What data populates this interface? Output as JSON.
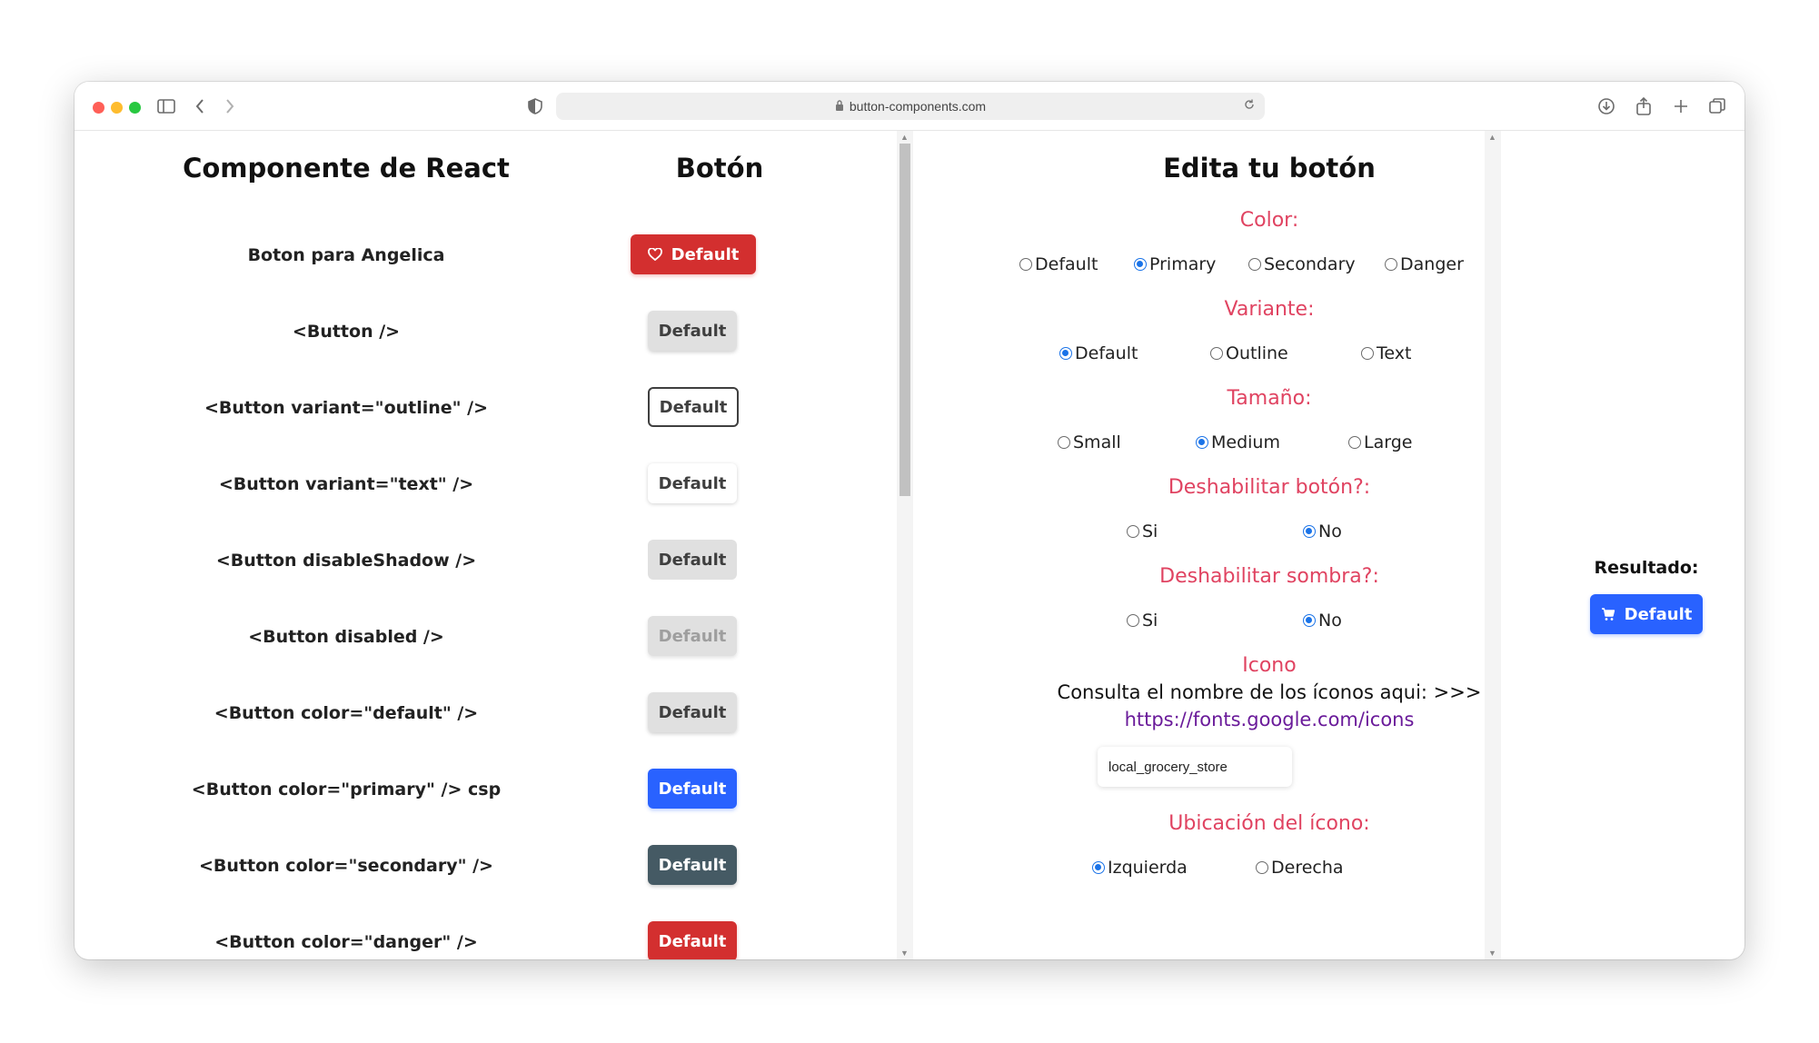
{
  "browser": {
    "url": "button-components.com"
  },
  "left": {
    "heading_component": "Componente de React",
    "heading_button": "Botón",
    "rows": [
      {
        "label": "Boton para Angelica",
        "button": "Default"
      },
      {
        "label": "<Button />",
        "button": "Default"
      },
      {
        "label": "<Button variant=\"outline\" />",
        "button": "Default"
      },
      {
        "label": "<Button variant=\"text\" />",
        "button": "Default"
      },
      {
        "label": "<Button disableShadow />",
        "button": "Default"
      },
      {
        "label": "<Button disabled />",
        "button": "Default"
      },
      {
        "label": "<Button color=\"default\" />",
        "button": "Default"
      },
      {
        "label": "<Button color=\"primary\" /> csp",
        "button": "Default"
      },
      {
        "label": "<Button color=\"secondary\" />",
        "button": "Default"
      },
      {
        "label": "<Button color=\"danger\" />",
        "button": "Default"
      }
    ]
  },
  "editor": {
    "heading": "Edita tu botón",
    "color": {
      "title": "Color:",
      "options": [
        "Default",
        "Primary",
        "Secondary",
        "Danger"
      ],
      "selected": "Primary"
    },
    "variant": {
      "title": "Variante:",
      "options": [
        "Default",
        "Outline",
        "Text"
      ],
      "selected": "Default"
    },
    "size": {
      "title": "Tamaño:",
      "options": [
        "Small",
        "Medium",
        "Large"
      ],
      "selected": "Medium"
    },
    "disable_button": {
      "title": "Deshabilitar botón?:",
      "options": [
        "Si",
        "No"
      ],
      "selected": "No"
    },
    "disable_shadow": {
      "title": "Deshabilitar sombra?:",
      "options": [
        "Si",
        "No"
      ],
      "selected": "No"
    },
    "icon": {
      "title": "Icono",
      "help_text": "Consulta el nombre de los íconos aqui: >>>",
      "link": "https://fonts.google.com/icons",
      "input_value": "local_grocery_store"
    },
    "icon_position": {
      "title": "Ubicación del ícono:",
      "options": [
        "Izquierda",
        "Derecha"
      ],
      "selected": "Izquierda"
    }
  },
  "result": {
    "label": "Resultado:",
    "button": "Default"
  },
  "colors": {
    "danger": "#d32f2f",
    "primary": "#2962ff",
    "secondary": "#455a64",
    "default": "#e0e0e0",
    "section_title": "#e04361",
    "link": "#6a1b9a"
  }
}
